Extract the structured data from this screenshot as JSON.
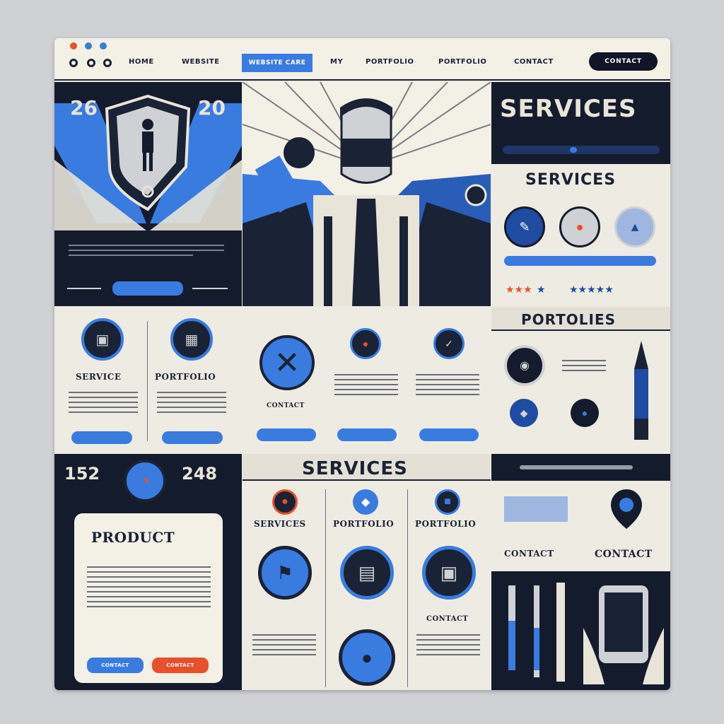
{
  "nav": {
    "links": [
      "HOME",
      "WEBSITE",
      "MY",
      "PORTFOLIO",
      "PORTFOLIO",
      "CONTACT"
    ],
    "active": "WEBSITE CARE",
    "cta": "CONTACT"
  },
  "stats": {
    "left": "26",
    "right": "20",
    "small_left": "152",
    "small_right": "248"
  },
  "services": {
    "title": "SERVICES",
    "subtitle": "SERVICES",
    "section2": "SERVICES"
  },
  "portfolio": {
    "title": "PORTOLIES"
  },
  "cards": {
    "left": {
      "t1": "SERVICE",
      "t2": "PORTFOLIO"
    },
    "mid": "CONTACT",
    "bottom": {
      "t1": "SERVICES",
      "t2": "PORTFOLIO",
      "t3": "PORTFOLIO",
      "t4": "CONTACT"
    }
  },
  "product": {
    "title": "PRODUCT",
    "btn1": "CONTACT",
    "btn2": "CONTACT"
  },
  "contact": {
    "title": "CONTACT",
    "small": "CONTACT"
  },
  "colors": {
    "accent": "#3a7be0",
    "dark": "#141b2d",
    "orange": "#e8502a"
  }
}
